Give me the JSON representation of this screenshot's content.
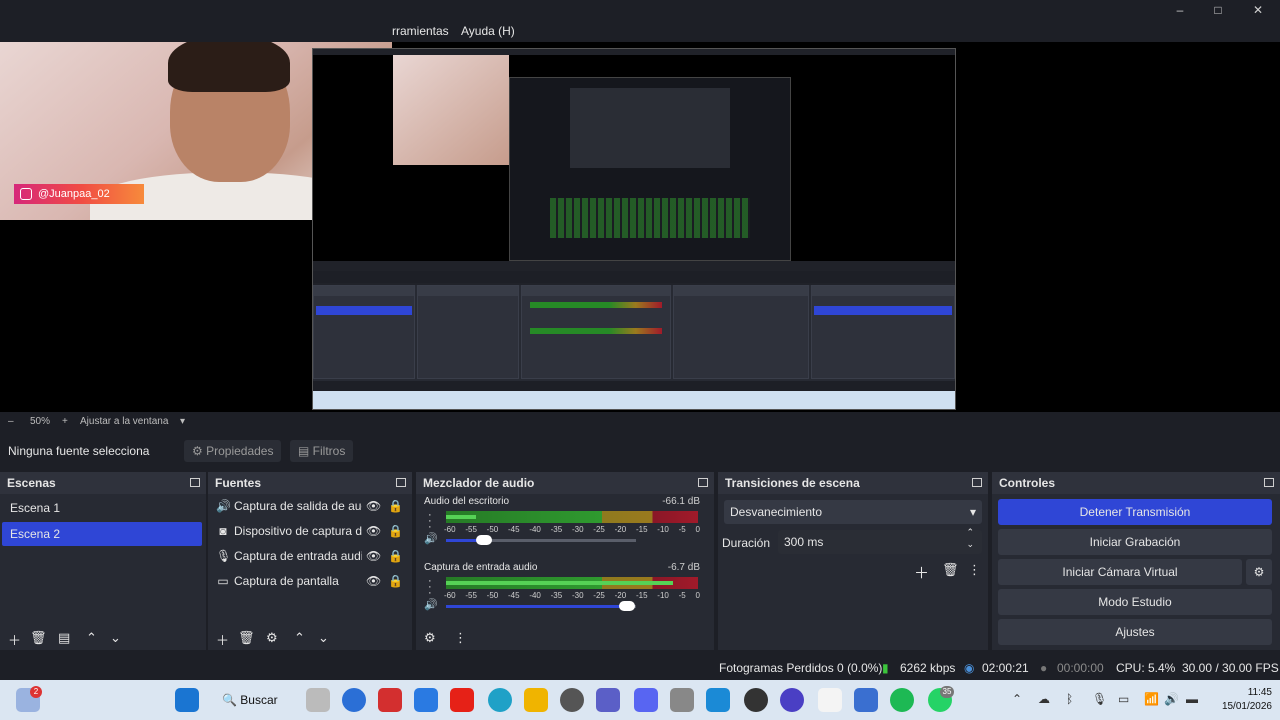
{
  "menu": {
    "tools": "rramientas",
    "help": "Ayuda (H)"
  },
  "window_controls": {
    "minimize": "–",
    "maximize": "□",
    "close": "✕"
  },
  "overlay": {
    "instagram": "@Juanpaa_02"
  },
  "preview_bar": {
    "zoom": "50%",
    "minus": "–",
    "plus": "+",
    "fit": "Ajustar a la ventana",
    "dropdown": "▾"
  },
  "source_toolbar": {
    "selection": "Ninguna fuente selecciona",
    "properties": "Propiedades",
    "filters": "Filtros"
  },
  "scenes": {
    "title": "Escenas",
    "items": [
      {
        "label": "Escena 1"
      },
      {
        "label": "Escena 2"
      }
    ]
  },
  "sources": {
    "title": "Fuentes",
    "items": [
      {
        "label": "Captura de salida de audi",
        "icon": "🔊"
      },
      {
        "label": "Dispositivo de captura de",
        "icon": "◙"
      },
      {
        "label": "Captura de entrada audic",
        "icon": "🎙"
      },
      {
        "label": "Captura de pantalla",
        "icon": "▭"
      }
    ]
  },
  "mixer": {
    "title": "Mezclador de audio",
    "ticks": [
      "-60",
      "-55",
      "-50",
      "-45",
      "-40",
      "-35",
      "-30",
      "-25",
      "-20",
      "-15",
      "-10",
      "-5",
      "0"
    ],
    "channels": [
      {
        "name": "Audio del escritorio",
        "db": "-66.1 dB",
        "level": 0.12,
        "volume": 0.2
      },
      {
        "name": "Captura de entrada audio",
        "db": "-6.7 dB",
        "level": 0.9,
        "volume": 0.95
      }
    ]
  },
  "transitions": {
    "title": "Transiciones de escena",
    "selected": "Desvanecimiento",
    "duration_label": "Duración",
    "duration_value": "300 ms"
  },
  "controls": {
    "title": "Controles",
    "stop_stream": "Detener Transmisión",
    "start_recording": "Iniciar Grabación",
    "start_virtual_cam": "Iniciar Cámara Virtual",
    "studio_mode": "Modo Estudio",
    "settings": "Ajustes"
  },
  "status": {
    "dropped_frames": "Fotogramas Perdidos 0 (0.0%)",
    "bitrate": "6262 kbps",
    "stream_time": "02:00:21",
    "record_time": "00:00:00",
    "cpu": "CPU: 5.4%",
    "fps": "30.00 / 30.00 FPS"
  },
  "taskbar": {
    "search": "Buscar",
    "time": "11:45",
    "date": "15/01/2026",
    "weather_badge": "2",
    "whatsapp_badge": "35"
  },
  "colors": {
    "accent": "#2f46d6",
    "dock_bg": "#272a33",
    "window_bg": "#1d1f26"
  }
}
